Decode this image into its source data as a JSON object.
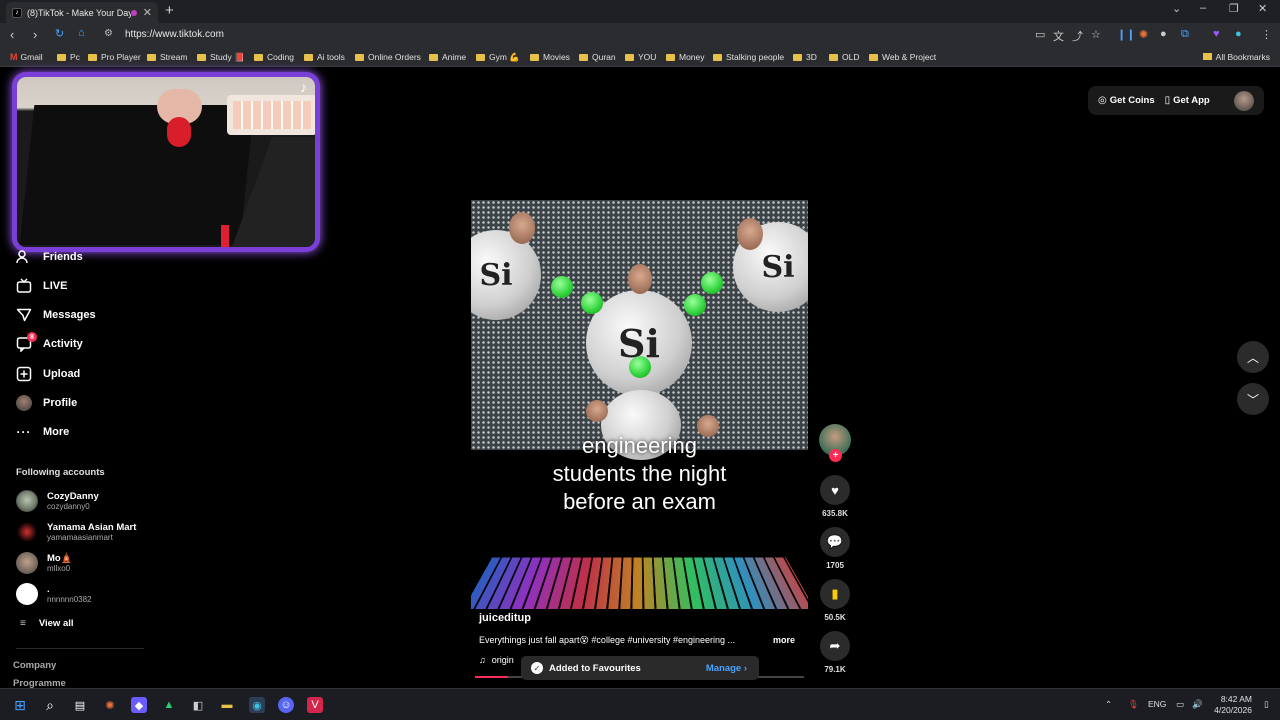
{
  "browser": {
    "tab_title": "(8)TikTok - Make Your Day",
    "tab_favicon": "tiktok-icon",
    "url": "https://www.tiktok.com",
    "bookmarks": [
      "Gmail",
      "Pc",
      "Pro Player",
      "Stream",
      "Study 📕",
      "Coding",
      "Ai tools",
      "Online Orders",
      "Anime",
      "Gym 💪",
      "Movies",
      "Quran",
      "YOU",
      "Money",
      "Stalking people",
      "3D",
      "OLD",
      "Web & Project"
    ],
    "all_bookmarks": "All Bookmarks"
  },
  "sidebar": {
    "nav": [
      {
        "label": "Friends",
        "icon": "friends-icon"
      },
      {
        "label": "LIVE",
        "icon": "live-icon"
      },
      {
        "label": "Messages",
        "icon": "messages-icon"
      },
      {
        "label": "Activity",
        "icon": "activity-icon",
        "badge": "8"
      },
      {
        "label": "Upload",
        "icon": "upload-icon"
      },
      {
        "label": "Profile",
        "icon": "profile-avatar"
      },
      {
        "label": "More",
        "icon": "more-icon"
      }
    ],
    "following_title": "Following accounts",
    "accounts": [
      {
        "name": "CozyDanny",
        "handle": "cozydanny0"
      },
      {
        "name": "Yamama Asian Mart",
        "handle": "yamamaasianmart"
      },
      {
        "name": "Mo🛕",
        "handle": "mllxo0"
      },
      {
        "name": ".",
        "handle": "nnnnnn0382"
      }
    ],
    "view_all": "View all",
    "footer": [
      "Company",
      "Programme"
    ]
  },
  "topbar": {
    "get_coins": "Get Coins",
    "get_app": "Get App"
  },
  "video": {
    "sphere_text": "Si",
    "caption_lines": [
      "engineering",
      "students the night",
      "before an exam"
    ],
    "author": "juiceditup",
    "description": "Everythings just fall apart😵 #college #university #engineering ...",
    "more": "more",
    "music": "origin",
    "progress": 0.1
  },
  "actions": {
    "likes": "635.8K",
    "comments": "1705",
    "saves": "50.5K",
    "shares": "79.1K"
  },
  "toast": {
    "message": "Added to Favourites",
    "action": "Manage"
  },
  "taskbar": {
    "language": "ENG",
    "time": "8:42 AM",
    "date": "4/20/2026"
  },
  "colors": {
    "accent": "#fe2c55",
    "webcam_border": "#7a3fd6",
    "link": "#4aa3ff"
  }
}
